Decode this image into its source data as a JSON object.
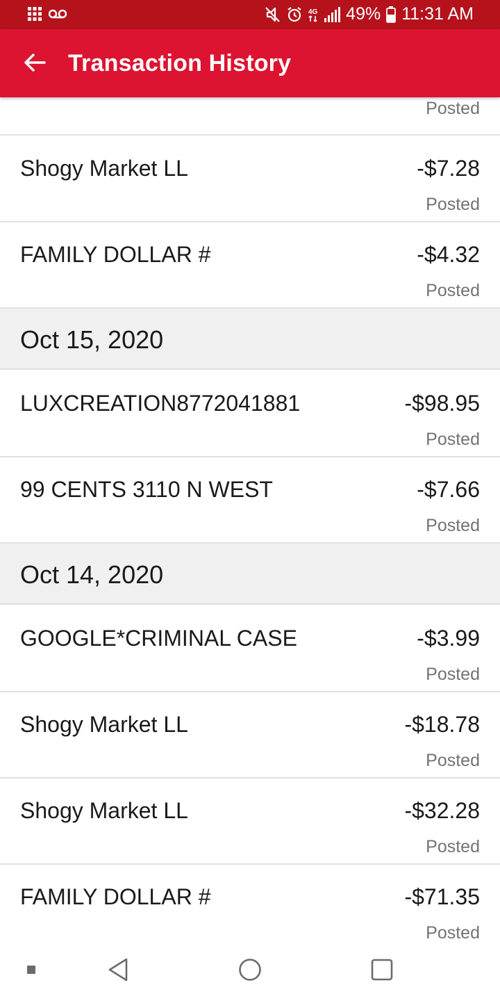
{
  "status_bar": {
    "battery": "49%",
    "time": "11:31 AM",
    "icons": [
      "apps-grid-icon",
      "voicemail-icon",
      "mute-icon",
      "alarm-icon",
      "wifi-calling-icon",
      "signal-icon",
      "battery-icon"
    ]
  },
  "app_bar": {
    "title": "Transaction History",
    "back_icon": "arrow-left-icon"
  },
  "partial_row": {
    "status": "Posted"
  },
  "rows_top": [
    {
      "merchant": "Shogy Market LL",
      "amount": "-$7.28",
      "status": "Posted"
    },
    {
      "merchant": "FAMILY DOLLAR #",
      "amount": "-$4.32",
      "status": "Posted"
    }
  ],
  "groups": [
    {
      "date": "Oct 15, 2020",
      "rows": [
        {
          "merchant": "LUXCREATION8772041881",
          "amount": "-$98.95",
          "status": "Posted"
        },
        {
          "merchant": "99 CENTS  3110 N WEST",
          "amount": "-$7.66",
          "status": "Posted"
        }
      ]
    },
    {
      "date": "Oct 14, 2020",
      "rows": [
        {
          "merchant": "GOOGLE*CRIMINAL CASE",
          "amount": "-$3.99",
          "status": "Posted"
        },
        {
          "merchant": "Shogy Market LL",
          "amount": "-$18.78",
          "status": "Posted"
        },
        {
          "merchant": "Shogy Market LL",
          "amount": "-$32.28",
          "status": "Posted"
        },
        {
          "merchant": "FAMILY DOLLAR #",
          "amount": "-$71.35",
          "status": "Posted"
        }
      ]
    }
  ],
  "nav_bar": {
    "icons": [
      "recent-dot-icon",
      "nav-back-icon",
      "home-icon",
      "overview-icon"
    ]
  },
  "colors": {
    "status_bar": "#b5121b",
    "app_bar": "#dc1431",
    "date_header": "#f0f0f0",
    "status_text": "#737373"
  }
}
